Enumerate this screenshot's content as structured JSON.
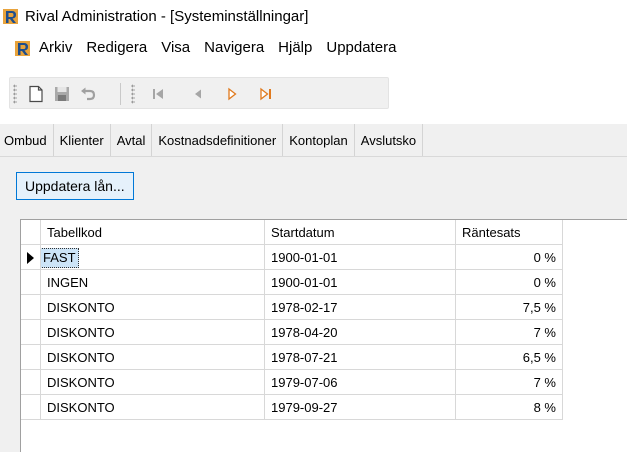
{
  "window": {
    "title": "Rival Administration - [Systeminställningar]"
  },
  "menu": {
    "items": [
      "Arkiv",
      "Redigera",
      "Visa",
      "Navigera",
      "Hjälp",
      "Uppdatera"
    ]
  },
  "toolbar": {
    "icons": [
      "new-document-icon",
      "save-icon",
      "undo-icon",
      "first-record-icon",
      "previous-record-icon",
      "next-record-icon",
      "last-record-icon"
    ]
  },
  "tabs": [
    "Ombud",
    "Klienter",
    "Avtal",
    "Kostnadsdefinitioner",
    "Kontoplan",
    "Avslutsko"
  ],
  "content": {
    "update_button_label": "Uppdatera lån..."
  },
  "table": {
    "columns": [
      "Tabellkod",
      "Startdatum",
      "Räntesats"
    ],
    "rows": [
      {
        "code": "FAST",
        "start": "1900-01-01",
        "rate": "0 %"
      },
      {
        "code": "INGEN",
        "start": "1900-01-01",
        "rate": "0 %"
      },
      {
        "code": "DISKONTO",
        "start": "1978-02-17",
        "rate": "7,5 %"
      },
      {
        "code": "DISKONTO",
        "start": "1978-04-20",
        "rate": "7 %"
      },
      {
        "code": "DISKONTO",
        "start": "1978-07-21",
        "rate": "6,5 %"
      },
      {
        "code": "DISKONTO",
        "start": "1979-07-06",
        "rate": "7 %"
      },
      {
        "code": "DISKONTO",
        "start": "1979-09-27",
        "rate": "8 %"
      }
    ]
  },
  "colors": {
    "accent": "#0078d7",
    "selection": "#cce4f7",
    "logo_orange": "#e8a33c",
    "logo_blue": "#1f4e8c"
  }
}
